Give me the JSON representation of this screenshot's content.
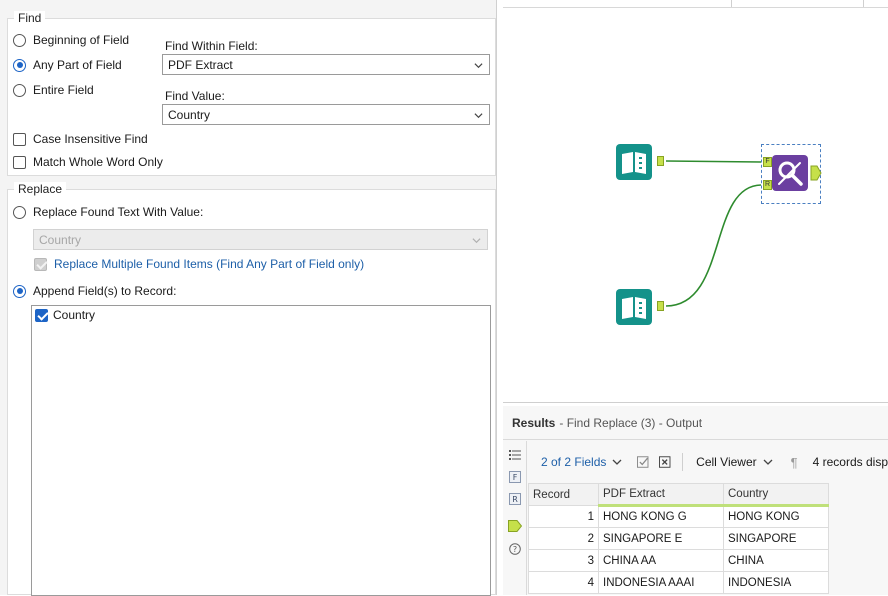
{
  "find": {
    "group_title": "Find",
    "options": [
      "Beginning of Field",
      "Any Part of Field",
      "Entire Field"
    ],
    "selected_option": "Any Part of Field",
    "find_within_label": "Find Within Field:",
    "find_within_value": "PDF Extract",
    "find_value_label": "Find Value:",
    "find_value_value": "Country",
    "case_insensitive_label": "Case Insensitive Find",
    "match_whole_word_label": "Match Whole Word Only"
  },
  "replace": {
    "group_title": "Replace",
    "replace_found_label": "Replace Found Text With Value:",
    "replace_value": "Country",
    "replace_multiple_label": "Replace Multiple Found Items (Find Any Part of Field only)",
    "append_label": "Append Field(s) to Record:",
    "append_fields": [
      {
        "label": "Country",
        "checked": true
      }
    ]
  },
  "canvas": {
    "tools": [
      "input-data-tool-top",
      "input-data-tool-bottom",
      "find-replace-tool"
    ],
    "anchor_f": "F",
    "anchor_r": "R",
    "colors": {
      "input_tool": "#14928a",
      "find_replace_tool": "#6b3fa0",
      "connection": "#2e8b2e",
      "anchor": "#c6e04a"
    }
  },
  "results": {
    "title": "Results",
    "subtitle": "- Find Replace (3) - Output",
    "fields_label": "2 of 2 Fields",
    "cell_viewer_label": "Cell Viewer",
    "records_label": "4 records disp",
    "columns": [
      "Record",
      "PDF Extract",
      "Country"
    ],
    "rows": [
      [
        "1",
        "HONG KONG G",
        "HONG KONG"
      ],
      [
        "2",
        "SINGAPORE E",
        "SINGAPORE"
      ],
      [
        "3",
        "CHINA AA",
        "CHINA"
      ],
      [
        "4",
        "INDONESIA AAAI",
        "INDONESIA"
      ]
    ]
  },
  "colors": {
    "accent": "#1d64c6",
    "link_text": "#1d5fa8",
    "field_header_underline": "#bfe07a"
  }
}
